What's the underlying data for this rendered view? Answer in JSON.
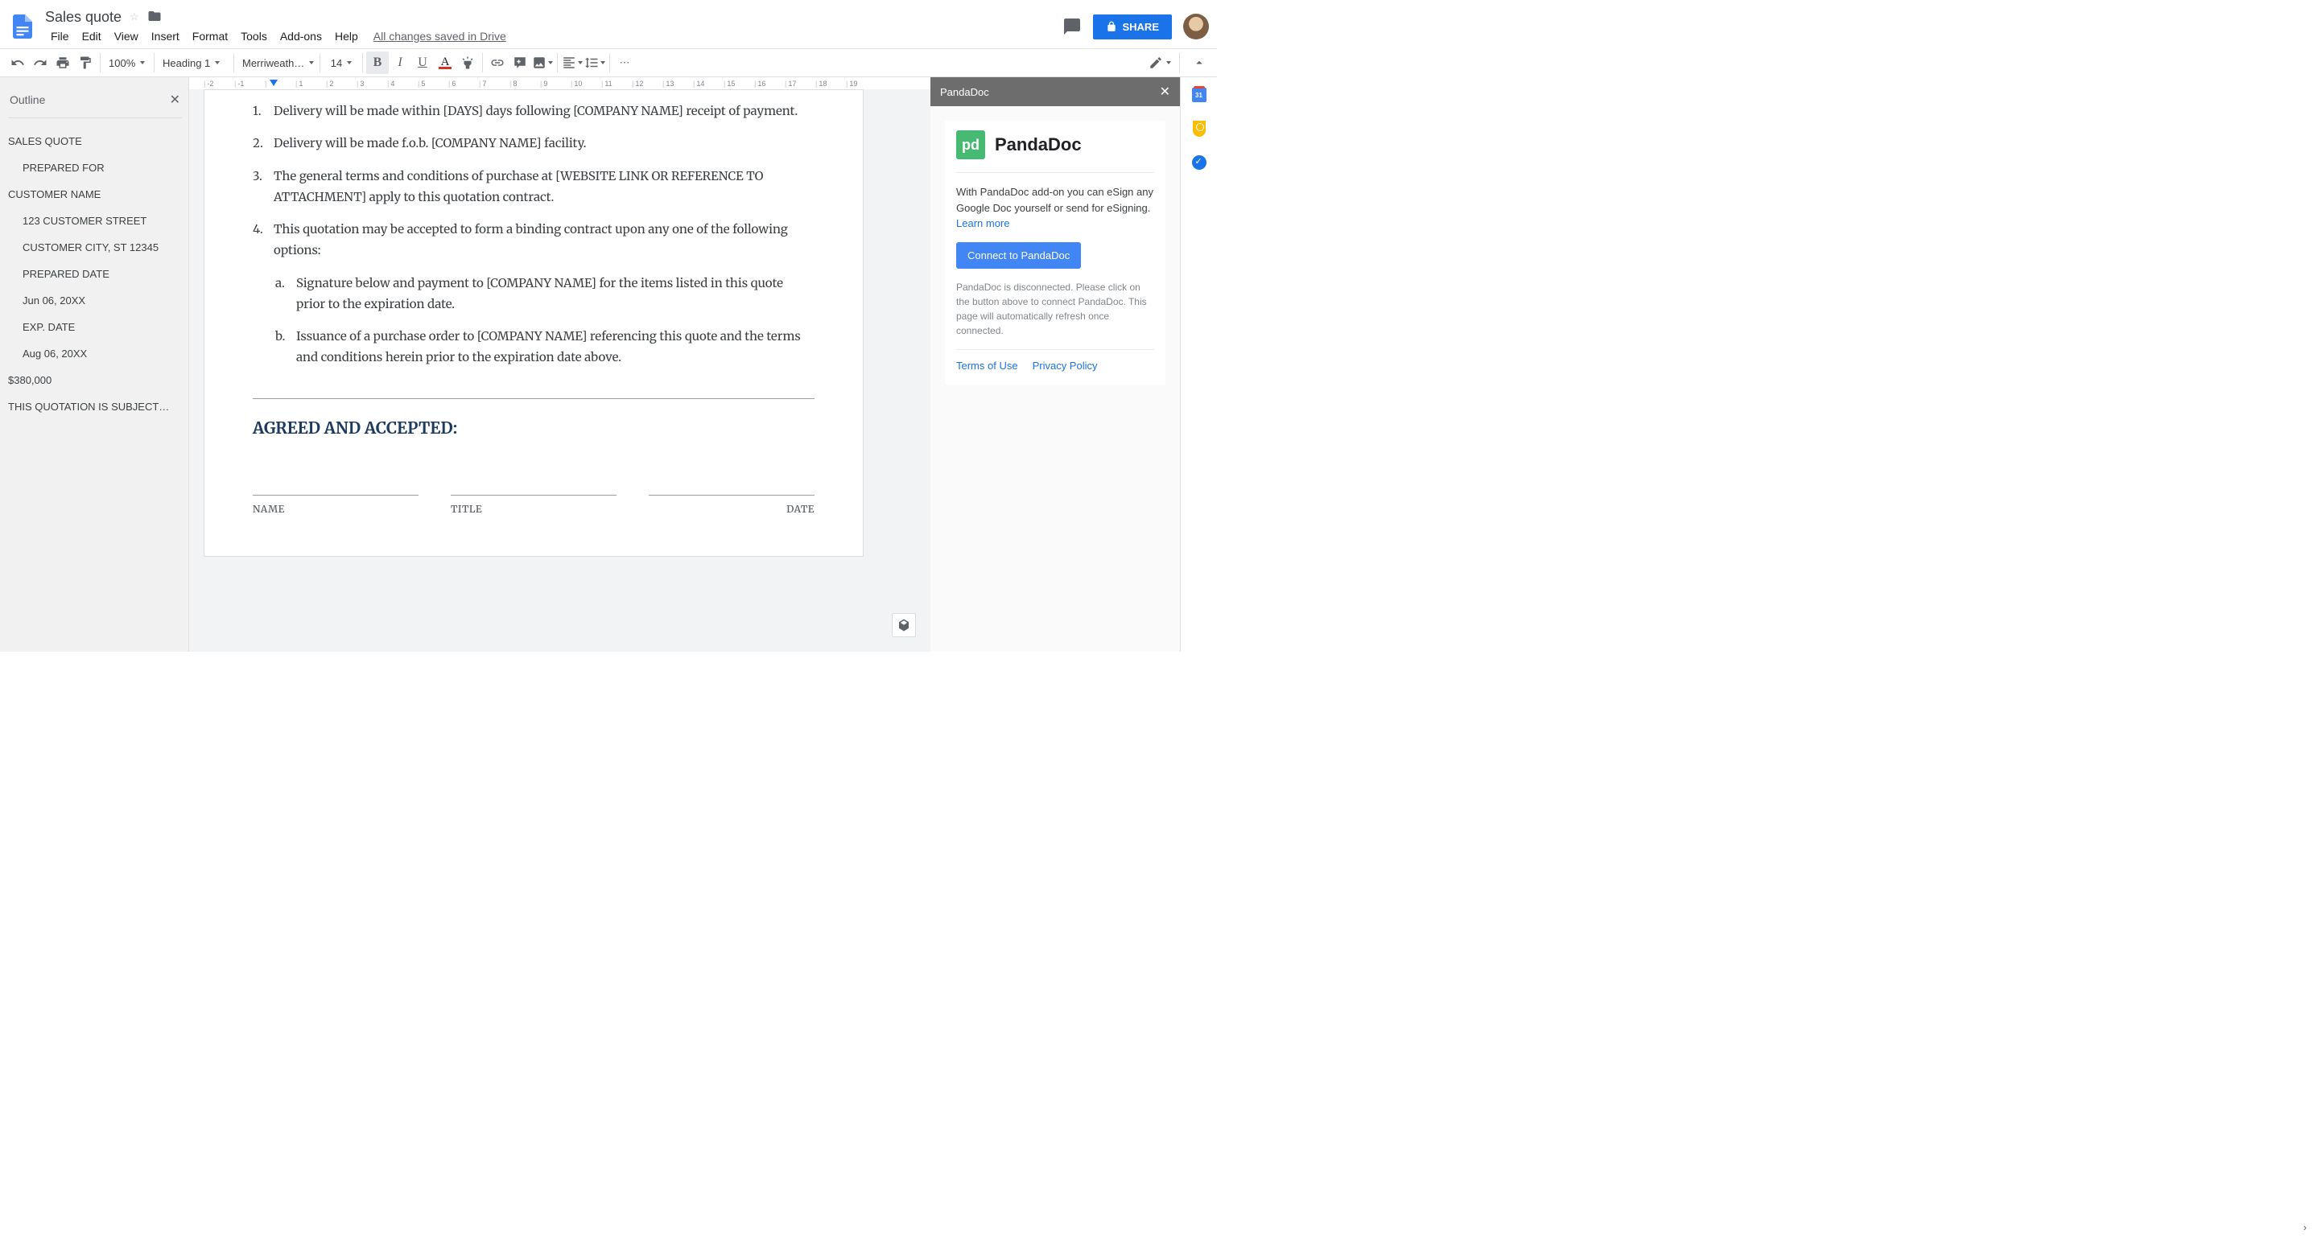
{
  "header": {
    "doc_title": "Sales quote",
    "menu": {
      "file": "File",
      "edit": "Edit",
      "view": "View",
      "insert": "Insert",
      "format": "Format",
      "tools": "Tools",
      "addons": "Add-ons",
      "help": "Help"
    },
    "saved": "All changes saved in Drive",
    "share": "SHARE"
  },
  "toolbar": {
    "zoom": "100%",
    "style": "Heading 1",
    "font": "Merriweath…",
    "size": "14"
  },
  "outline": {
    "title": "Outline",
    "items": [
      {
        "label": "SALES QUOTE",
        "level": 0
      },
      {
        "label": "PREPARED FOR",
        "level": 1
      },
      {
        "label": "CUSTOMER NAME",
        "level": 0
      },
      {
        "label": "123 CUSTOMER STREET",
        "level": 2
      },
      {
        "label": "CUSTOMER CITY, ST 12345",
        "level": 2
      },
      {
        "label": "PREPARED DATE",
        "level": 2
      },
      {
        "label": "Jun 06, 20XX",
        "level": 2
      },
      {
        "label": "EXP. DATE",
        "level": 2
      },
      {
        "label": "Aug 06, 20XX",
        "level": 2
      },
      {
        "label": "$380,000",
        "level": 0
      },
      {
        "label": "THIS QUOTATION IS SUBJECT…",
        "level": 0
      }
    ]
  },
  "document": {
    "items": [
      {
        "n": "1.",
        "t": "Delivery will be made within [DAYS] days following [COMPANY NAME] receipt of payment."
      },
      {
        "n": "2.",
        "t": "Delivery will be made f.o.b. [COMPANY NAME] facility."
      },
      {
        "n": "3.",
        "t": "The general terms and conditions of purchase at [WEBSITE LINK OR REFERENCE TO ATTACHMENT] apply to this quotation contract."
      },
      {
        "n": "4.",
        "t": "This quotation may be accepted to form a binding contract upon any one of the following options:"
      }
    ],
    "subitems": [
      {
        "n": "a.",
        "t": "Signature below and payment to [COMPANY NAME] for the items listed in this quote prior to the expiration date."
      },
      {
        "n": "b.",
        "t": "Issuance of a purchase order to [COMPANY NAME] referencing this quote and the terms and conditions herein prior to the expiration date above."
      }
    ],
    "heading": "AGREED AND ACCEPTED:",
    "sig": {
      "name": "NAME",
      "title": "TITLE",
      "date": "DATE"
    }
  },
  "ruler": {
    "marks": [
      "-2",
      "-1",
      "",
      "1",
      "2",
      "3",
      "4",
      "5",
      "6",
      "7",
      "8",
      "9",
      "10",
      "11",
      "12",
      "13",
      "14",
      "15",
      "16",
      "17",
      "18",
      "19"
    ]
  },
  "panda": {
    "title": "PandaDoc",
    "brand": "PandaDoc",
    "desc": "With PandaDoc add-on you can eSign any Google Doc yourself or send for eSigning.",
    "learn": "Learn more",
    "connect": "Connect to PandaDoc",
    "note": "PandaDoc is disconnected. Please click on the button above to connect PandaDoc. This page will automatically refresh once connected.",
    "tos": "Terms of Use",
    "privacy": "Privacy Policy"
  },
  "rail": {
    "cal": "31"
  }
}
